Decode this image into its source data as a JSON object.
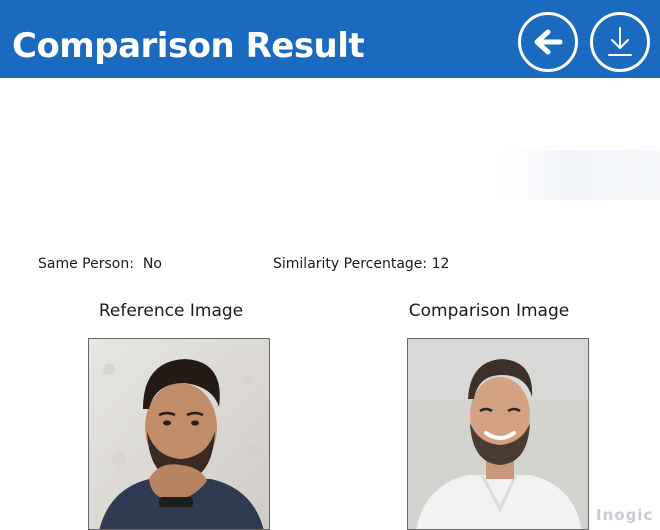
{
  "header": {
    "title": "Comparison Result",
    "background_color": "#1a6bbf",
    "back_button_icon": "arrow-left-icon",
    "download_button_icon": "download-icon"
  },
  "result": {
    "same_person_label": "Same Person:",
    "same_person_value": "No",
    "similarity_label": "Similarity Percentage:",
    "similarity_value": "12"
  },
  "images": {
    "reference_label": "Reference Image",
    "comparison_label": "Comparison Image"
  },
  "watermark": {
    "brand": "Inogic"
  }
}
